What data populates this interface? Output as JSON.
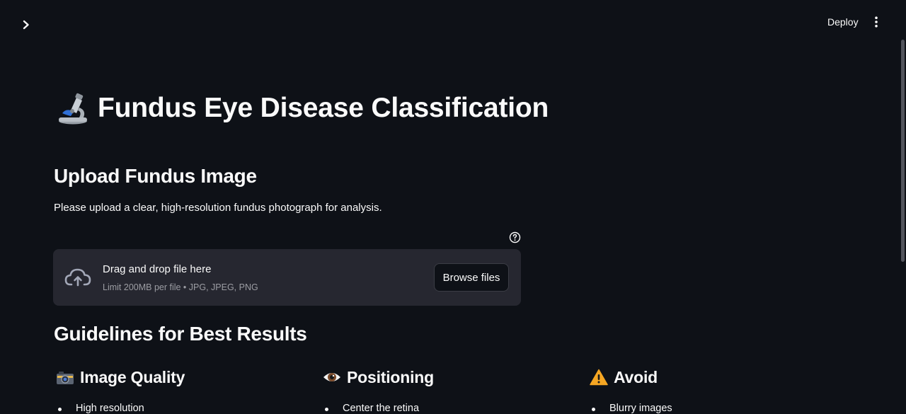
{
  "header": {
    "deploy_label": "Deploy"
  },
  "main": {
    "title": "Fundus Eye Disease Classification",
    "upload_heading": "Upload Fundus Image",
    "upload_description": "Please upload a clear, high-resolution fundus photograph for analysis.",
    "uploader": {
      "drag_text": "Drag and drop file here",
      "limit_text": "Limit 200MB per file • JPG, JPEG, PNG",
      "browse_label": "Browse files"
    },
    "guidelines_heading": "Guidelines for Best Results",
    "columns": [
      {
        "icon": "camera-icon",
        "title": "Image Quality",
        "items": [
          "High resolution"
        ]
      },
      {
        "icon": "eye-icon",
        "title": "Positioning",
        "items": [
          "Center the retina"
        ]
      },
      {
        "icon": "warning-icon",
        "title": "Avoid",
        "items": [
          "Blurry images"
        ]
      }
    ]
  }
}
